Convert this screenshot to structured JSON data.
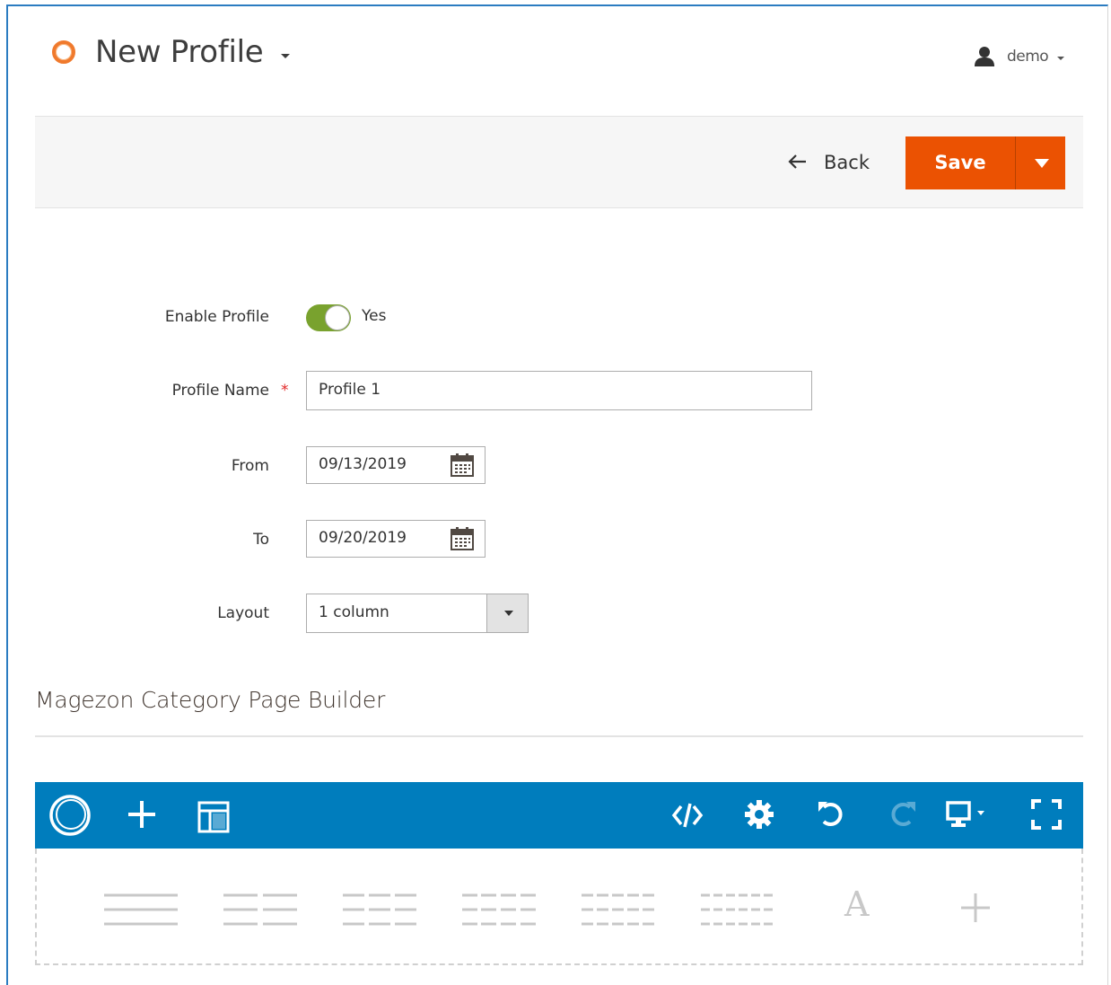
{
  "header": {
    "title": "New Profile",
    "user_name": "demo"
  },
  "actions": {
    "back_label": "Back",
    "save_label": "Save"
  },
  "form": {
    "enable_label": "Enable Profile",
    "enable_value": "Yes",
    "name_label": "Profile Name",
    "required_mark": "*",
    "name_value": "Profile 1",
    "from_label": "From",
    "from_value": "09/13/2019",
    "to_label": "To",
    "to_value": "09/20/2019",
    "layout_label": "Layout",
    "layout_value": "1 column"
  },
  "builder": {
    "section_title": "Magezon Category Page Builder",
    "text_element": "A"
  },
  "colors": {
    "accent": "#eb5202",
    "builder_bar": "#007dbd",
    "toggle_on": "#79a22e",
    "logo": "#f07a2d"
  },
  "icons": [
    "logo-icon",
    "user-icon",
    "back-arrow-icon",
    "calendar-icon",
    "magezon-logo-icon",
    "add-icon",
    "templates-icon",
    "code-icon",
    "settings-icon",
    "undo-icon",
    "redo-icon",
    "desktop-device-icon",
    "fullscreen-icon"
  ]
}
